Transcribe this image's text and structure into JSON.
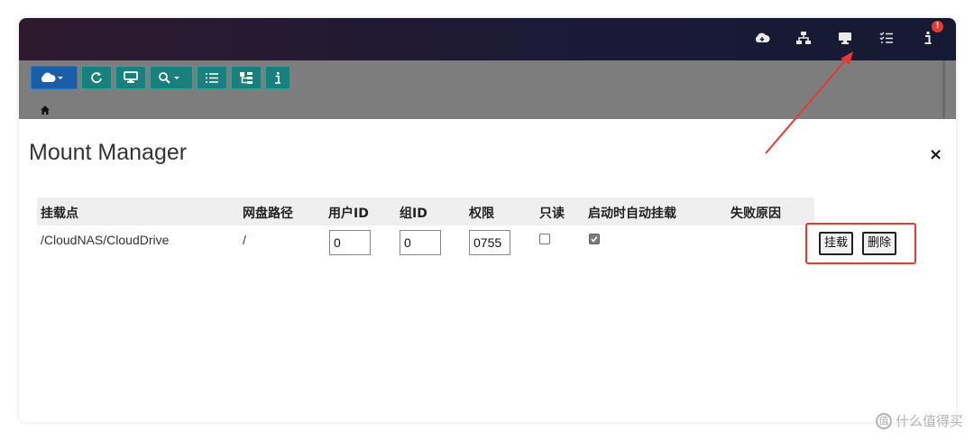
{
  "topbar": {
    "icons": [
      "cloud-icon",
      "network-icon",
      "monitor-icon",
      "checklist-icon",
      "info-icon"
    ],
    "badge": "!"
  },
  "toolbar": {
    "buttons": [
      "cloud-dropdown-icon",
      "refresh-icon",
      "monitor-icon",
      "search-dropdown-icon",
      "list-icon",
      "tree-icon",
      "info-icon"
    ]
  },
  "breadcrumb": {
    "home": "home-icon"
  },
  "dialog": {
    "title": "Mount Manager",
    "close": "×"
  },
  "table": {
    "headers": [
      "挂载点",
      "网盘路径",
      "用户ID",
      "组ID",
      "权限",
      "只读",
      "启动时自动挂载",
      "失败原因"
    ],
    "rows": [
      {
        "mount_point": "/CloudNAS/CloudDrive",
        "drive_path": "/",
        "user_id": "0",
        "group_id": "0",
        "permission": "0755",
        "read_only": false,
        "auto_mount": true,
        "fail_reason": "",
        "mount_label": "挂载",
        "delete_label": "删除"
      }
    ]
  },
  "colors": {
    "topbar": "#1c1a34",
    "toolbar_button": "#19807e",
    "highlight": "#e53935"
  },
  "watermark": {
    "mark": "值",
    "text": "什么值得买"
  }
}
